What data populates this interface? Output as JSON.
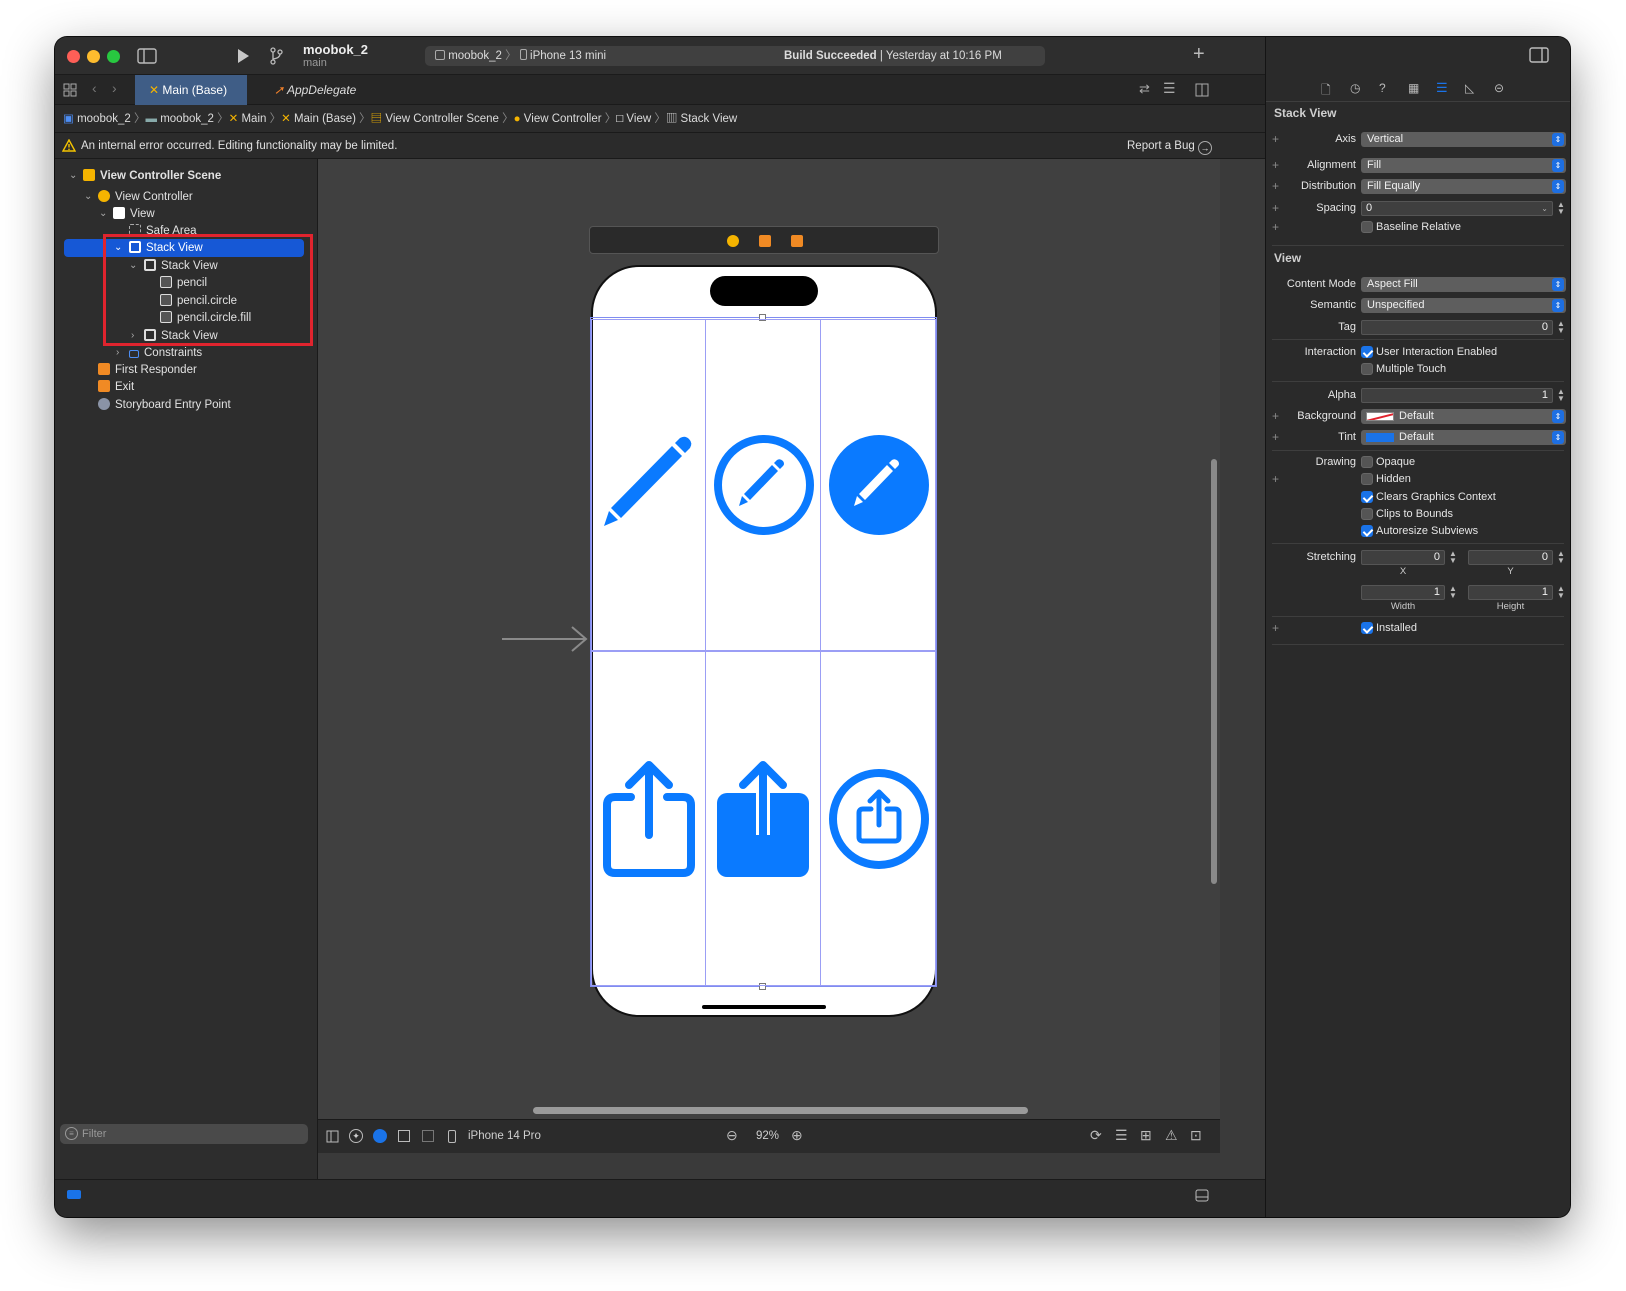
{
  "window": {
    "project_name": "moobok_2",
    "branch": "main",
    "scheme": "moobok_2",
    "destination": "iPhone 13 mini",
    "build_status_bold": "Build Succeeded",
    "build_status_time": "| Yesterday at 10:16 PM"
  },
  "tabs": [
    {
      "label": "Main (Base)"
    },
    {
      "label": "AppDelegate"
    }
  ],
  "breadcrumb": [
    "moobok_2",
    "moobok_2",
    "Main",
    "Main (Base)",
    "View Controller Scene",
    "View Controller",
    "View",
    "Stack View"
  ],
  "warning": {
    "message": "An internal error occurred. Editing functionality may be limited.",
    "report_label": "Report a Bug"
  },
  "outline": [
    {
      "label": "View Controller Scene",
      "depth": 0,
      "icon": "scene-icon",
      "expanded": true
    },
    {
      "label": "View Controller",
      "depth": 1,
      "icon": "view-controller-icon",
      "expanded": true
    },
    {
      "label": "View",
      "depth": 2,
      "icon": "view-icon",
      "expanded": true
    },
    {
      "label": "Safe Area",
      "depth": 3,
      "icon": "safe-area-icon"
    },
    {
      "label": "Stack View",
      "depth": 3,
      "icon": "stack-view-icon",
      "expanded": true,
      "selected": true
    },
    {
      "label": "Stack View",
      "depth": 4,
      "icon": "stack-view-icon",
      "expanded": true
    },
    {
      "label": "pencil",
      "depth": 5,
      "icon": "image-view-icon"
    },
    {
      "label": "pencil.circle",
      "depth": 5,
      "icon": "image-view-icon"
    },
    {
      "label": "pencil.circle.fill",
      "depth": 5,
      "icon": "image-view-icon"
    },
    {
      "label": "Stack View",
      "depth": 4,
      "icon": "stack-view-icon",
      "expanded": false
    },
    {
      "label": "Constraints",
      "depth": 3,
      "icon": "constraints-icon",
      "expanded": false
    },
    {
      "label": "First Responder",
      "depth": 1,
      "icon": "first-responder-icon"
    },
    {
      "label": "Exit",
      "depth": 1,
      "icon": "exit-icon"
    },
    {
      "label": "Storyboard Entry Point",
      "depth": 1,
      "icon": "entry-point-icon"
    }
  ],
  "filter_placeholder": "Filter",
  "canvas": {
    "device": "iPhone 14 Pro",
    "zoom": "92%",
    "symbols_row1": [
      "pencil",
      "pencil.circle",
      "pencil.circle.fill"
    ],
    "symbols_row2": [
      "square.and.arrow.up",
      "square.and.arrow.up.fill",
      "square.and.arrow.up.circle"
    ]
  },
  "inspector": {
    "stack_header": "Stack View",
    "axis_label": "Axis",
    "axis_value": "Vertical",
    "alignment_label": "Alignment",
    "alignment_value": "Fill",
    "distribution_label": "Distribution",
    "distribution_value": "Fill Equally",
    "spacing_label": "Spacing",
    "spacing_value": "0",
    "baseline_label": "Baseline Relative",
    "view_header": "View",
    "content_mode_label": "Content Mode",
    "content_mode_value": "Aspect Fill",
    "semantic_label": "Semantic",
    "semantic_value": "Unspecified",
    "tag_label": "Tag",
    "tag_value": "0",
    "interaction_label": "Interaction",
    "user_interaction_label": "User Interaction Enabled",
    "multiple_touch_label": "Multiple Touch",
    "alpha_label": "Alpha",
    "alpha_value": "1",
    "background_label": "Background",
    "background_value": "Default",
    "tint_label": "Tint",
    "tint_value": "Default",
    "drawing_label": "Drawing",
    "opaque_label": "Opaque",
    "hidden_label": "Hidden",
    "clears_label": "Clears Graphics Context",
    "clips_label": "Clips to Bounds",
    "autoresize_label": "Autoresize Subviews",
    "stretching_label": "Stretching",
    "stretch_x": "0",
    "stretch_y": "0",
    "stretch_w": "1",
    "stretch_h": "1",
    "x_label": "X",
    "y_label": "Y",
    "width_label": "Width",
    "height_label": "Height",
    "installed_label": "Installed"
  },
  "colors": {
    "accent": "#1a73e8",
    "symbol_blue": "#0a7aff",
    "selection": "#1658d6",
    "highlight_box": "#e0242e"
  }
}
